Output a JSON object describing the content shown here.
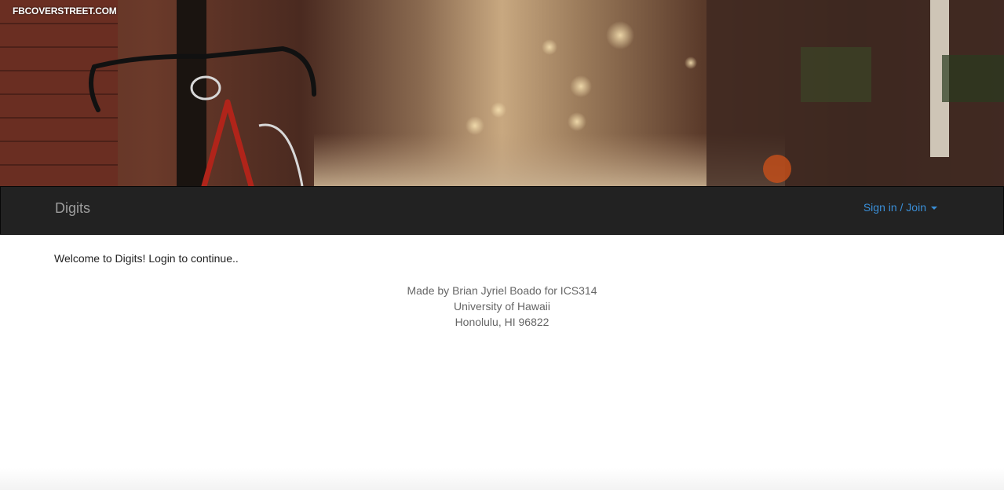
{
  "hero": {
    "watermark": "FBCOVERSTREET.COM"
  },
  "navbar": {
    "brand": "Digits",
    "signin_label": "Sign in / Join"
  },
  "main": {
    "welcome": "Welcome to Digits! Login to continue.."
  },
  "footer": {
    "line1": "Made by Brian Jyriel Boado for ICS314",
    "line2": "University of Hawaii",
    "line3": "Honolulu, HI 96822"
  },
  "colors": {
    "navbar_bg": "#222222",
    "link": "#3a8fd8",
    "brand": "#9d9d9d"
  }
}
